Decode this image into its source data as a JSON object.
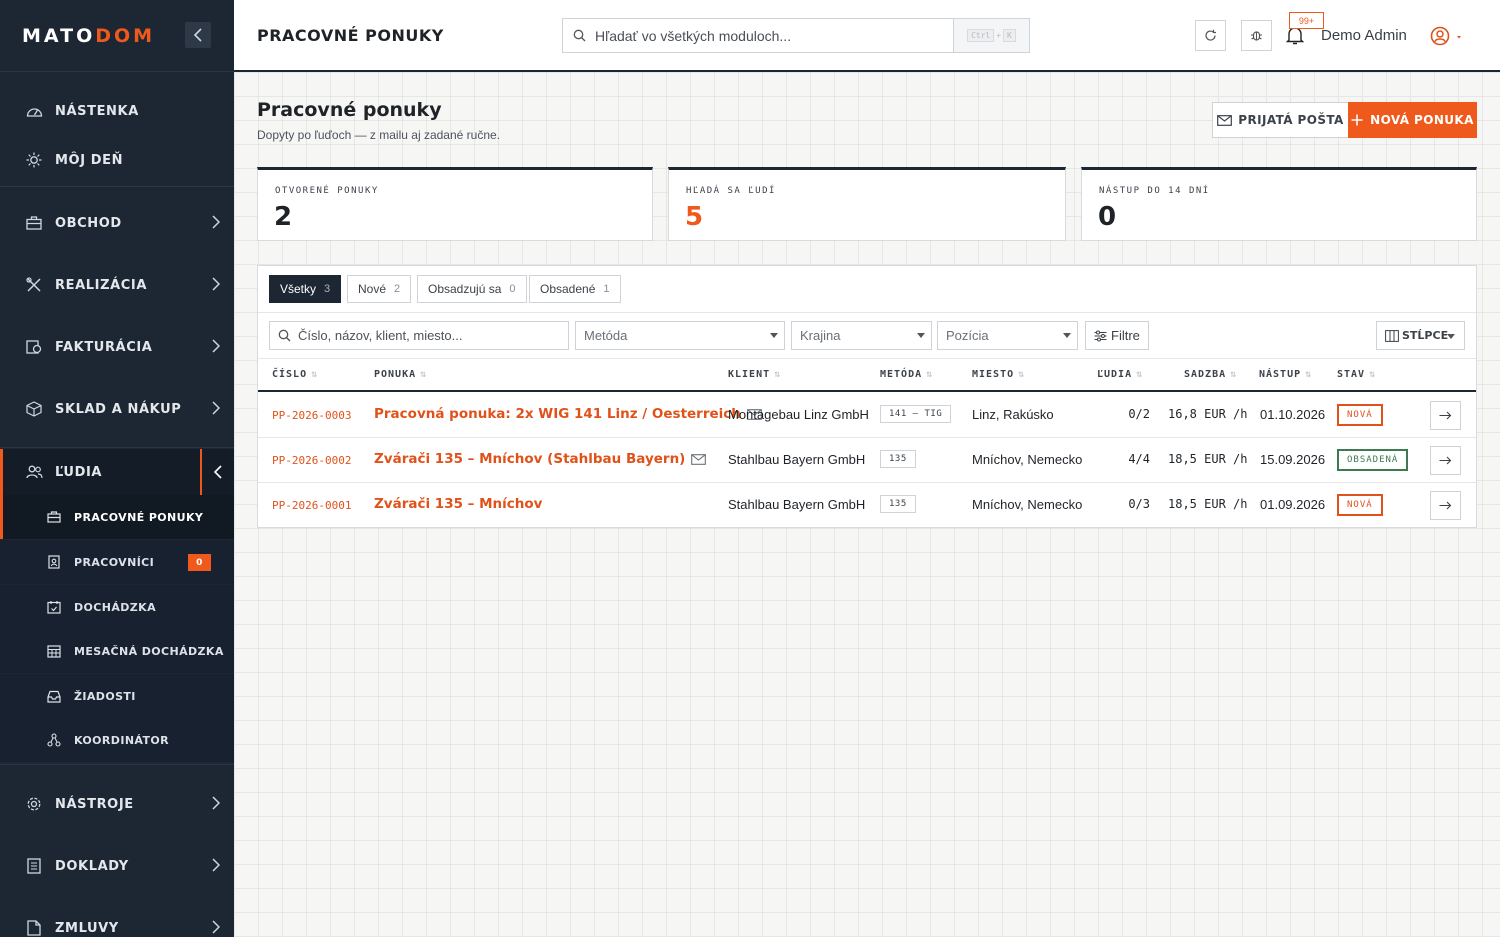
{
  "brand": {
    "part1": "MATO",
    "part2": "DOM"
  },
  "sidebar": {
    "items": [
      {
        "label": "NÁSTENKA",
        "icon": "dashboard-icon"
      },
      {
        "label": "MÔJ DEŇ",
        "icon": "sun-icon"
      },
      {
        "label": "OBCHOD",
        "icon": "briefcase-icon"
      },
      {
        "label": "REALIZÁCIA",
        "icon": "tools-icon"
      },
      {
        "label": "FAKTURÁCIA",
        "icon": "invoice-icon"
      },
      {
        "label": "SKLAD A NÁKUP",
        "icon": "box-icon"
      },
      {
        "label": "ĽUDIA",
        "icon": "people-icon"
      },
      {
        "label": "NÁSTROJE",
        "icon": "gear-icon"
      },
      {
        "label": "DOKLADY",
        "icon": "document-icon"
      },
      {
        "label": "ZMLUVY",
        "icon": "contract-icon"
      }
    ],
    "sub_items": [
      {
        "label": "PRACOVNÉ PONUKY",
        "icon": "briefcase-icon"
      },
      {
        "label": "PRACOVNÍCI",
        "icon": "badge-icon",
        "badge": "0"
      },
      {
        "label": "DOCHÁDZKA",
        "icon": "calendar-check-icon"
      },
      {
        "label": "MESAČNÁ DOCHÁDZKA",
        "icon": "calendar-grid-icon"
      },
      {
        "label": "ŽIADOSTI",
        "icon": "inbox-icon"
      },
      {
        "label": "KOORDINÁTOR",
        "icon": "network-icon"
      }
    ]
  },
  "topbar": {
    "title": "PRACOVNÉ PONUKY",
    "search_placeholder": "Hľadať vo všetkých moduloch...",
    "shortcut_key1": "Ctrl",
    "shortcut_plus": "+",
    "shortcut_key2": "K",
    "notifications": "99+",
    "user": "Demo Admin"
  },
  "page": {
    "title": "Pracovné ponuky",
    "subtitle": "Dopyty po ľuďoch — z mailu aj zadané ručne.",
    "inbox_button": "PRIJATÁ POŠTA",
    "new_button": "NOVÁ PONUKA"
  },
  "stats": [
    {
      "label": "OTVORENÉ PONUKY",
      "value": "2",
      "color": "#1f2328"
    },
    {
      "label": "HĽADÁ SA ĽUDÍ",
      "value": "5",
      "color": "#ef5a1c"
    },
    {
      "label": "NÁSTUP DO 14 DNÍ",
      "value": "0",
      "color": "#1f2328"
    }
  ],
  "tabs": [
    {
      "label": "Všetky",
      "count": "3"
    },
    {
      "label": "Nové",
      "count": "2"
    },
    {
      "label": "Obsadzujú sa",
      "count": "0"
    },
    {
      "label": "Obsadené",
      "count": "1"
    }
  ],
  "filters": {
    "search_placeholder": "Číslo, názov, klient, miesto...",
    "method": "Metóda",
    "country": "Krajina",
    "position": "Pozícia",
    "filters_button": "Filtre",
    "columns_button": "STĹPCE"
  },
  "table": {
    "headers": [
      "ČÍSLO",
      "PONUKA",
      "KLIENT",
      "METÓDA",
      "MIESTO",
      "ĽUDIA",
      "SADZBA",
      "NÁSTUP",
      "STAV"
    ],
    "rows": [
      {
        "id": "PP-2026-0003",
        "name": "Pracovná ponuka: 2x WIG 141 Linz / Oesterreich",
        "mail": true,
        "client": "Montagebau Linz GmbH",
        "method": "141 – TIG",
        "place": "Linz, Rakúsko",
        "people": "0/2",
        "rate": "16,8 EUR /h",
        "start": "01.10.2026",
        "status": "NOVÁ",
        "status_color": "#e0521a"
      },
      {
        "id": "PP-2026-0002",
        "name": "Zvárači 135 – Mníchov (Stahlbau Bayern)",
        "mail": true,
        "client": "Stahlbau Bayern GmbH",
        "method": "135",
        "place": "Mníchov, Nemecko",
        "people": "4/4",
        "rate": "18,5 EUR /h",
        "start": "15.09.2026",
        "status": "OBSADENÁ",
        "status_color": "#3d7a52"
      },
      {
        "id": "PP-2026-0001",
        "name": "Zvárači 135 – Mníchov",
        "mail": false,
        "client": "Stahlbau Bayern GmbH",
        "method": "135",
        "place": "Mníchov, Nemecko",
        "people": "0/3",
        "rate": "18,5 EUR /h",
        "start": "01.09.2026",
        "status": "NOVÁ",
        "status_color": "#e0521a"
      }
    ]
  },
  "colors": {
    "accent": "#ef5a1c",
    "sidebar": "#1d2734",
    "success": "#3d7a52"
  }
}
